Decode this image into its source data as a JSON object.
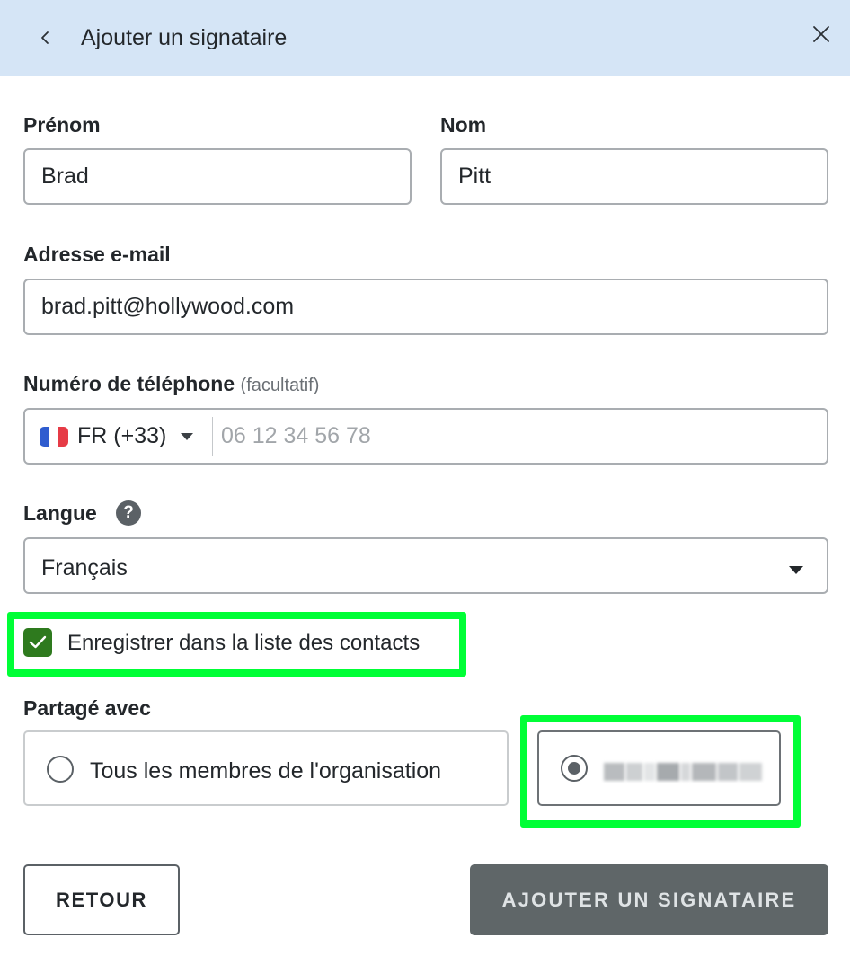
{
  "header": {
    "title": "Ajouter un signataire",
    "background": "#d5e5f6",
    "back_icon": "chevron-left-icon",
    "close_icon": "close-icon"
  },
  "form": {
    "first_name": {
      "label": "Prénom",
      "value": "Brad"
    },
    "last_name": {
      "label": "Nom",
      "value": "Pitt"
    },
    "email": {
      "label": "Adresse e-mail",
      "value": "brad.pitt@hollywood.com"
    },
    "phone": {
      "label": "Numéro de téléphone",
      "optional": "(facultatif)",
      "country_code": "FR (+33)",
      "placeholder": "06 12 34 56 78",
      "flag_colors": [
        "#2f5ccf",
        "#ffffff",
        "#e63b46"
      ]
    },
    "language": {
      "label": "Langue",
      "help_icon": "question-icon",
      "help_glyph": "?",
      "value": "Français"
    },
    "save_contact": {
      "label": "Enregistrer dans la liste des contacts",
      "checked": true
    },
    "shared_with": {
      "label": "Partagé avec",
      "options": [
        {
          "label": "Tous les membres de l'organisation",
          "selected": false
        },
        {
          "label": "",
          "selected": true,
          "redacted": true
        }
      ]
    }
  },
  "buttons": {
    "back_label": "RETOUR",
    "submit_label": "AJOUTER UN SIGNATAIRE"
  },
  "colors": {
    "highlight": "#00ff36",
    "checkbox": "#2e7a1e",
    "primary_button": "#5f6668"
  }
}
